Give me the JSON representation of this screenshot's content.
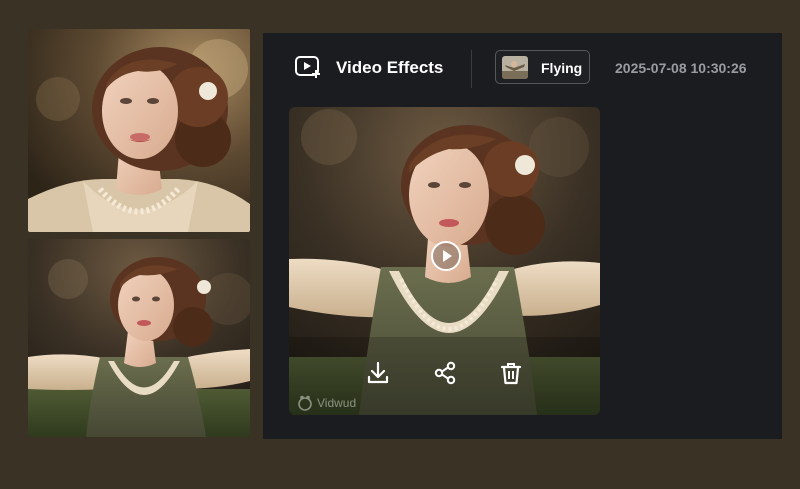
{
  "header": {
    "title": "Video Effects",
    "effect_tag": "Flying",
    "timestamp": "2025-07-08 10:30:26"
  },
  "preview": {
    "watermark": "Vidwud"
  },
  "icons": {
    "header": "video-effects-icon",
    "play": "play-icon",
    "download": "download-icon",
    "share": "share-icon",
    "delete": "trash-icon",
    "watermark": "vidwud-logo-icon"
  },
  "colors": {
    "page_background": "#3b3226",
    "panel_background": "#1b1c1f",
    "title_text": "#ffffff",
    "timestamp_text": "#9a9ca2",
    "tag_border": "#55575d"
  }
}
